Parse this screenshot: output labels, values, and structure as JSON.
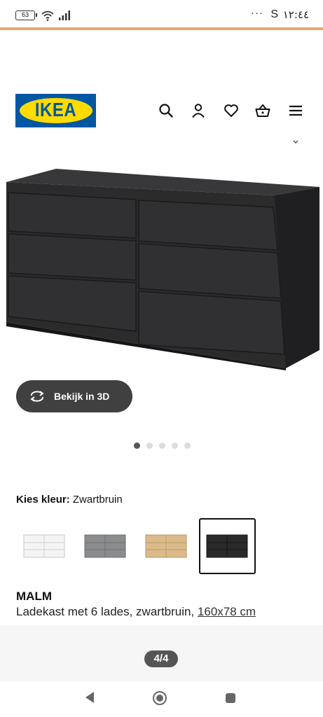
{
  "status_bar": {
    "battery": "63",
    "time": "١٢:٤٤",
    "carrier_letter": "S",
    "more": "···"
  },
  "header": {
    "logo_text": "IKEA",
    "icons": [
      "search-icon",
      "profile-icon",
      "heart-icon",
      "basket-icon",
      "menu-icon"
    ]
  },
  "product": {
    "view3d_label": "Bekijk in 3D",
    "image_dots": {
      "count": 5,
      "active": 1
    },
    "color_label": "Kies kleur:",
    "color_value": "Zwartbruin",
    "swatches": [
      {
        "name": "white",
        "color": "#f2f2f2"
      },
      {
        "name": "grey",
        "color": "#8a8c8d"
      },
      {
        "name": "oak",
        "color": "#d8b887"
      },
      {
        "name": "black-brown",
        "color": "#2a2a2a",
        "selected": true
      }
    ],
    "name": "MALM",
    "description": "Ladekast met 6 lades, zwartbruin,",
    "size": "160x78 cm"
  },
  "pager": {
    "label": "4/4"
  },
  "colors": {
    "ikea_blue": "#0058a3",
    "ikea_yellow": "#ffdb00",
    "accent_line": "#e8a46e",
    "dresser": "#2b2b2c"
  }
}
